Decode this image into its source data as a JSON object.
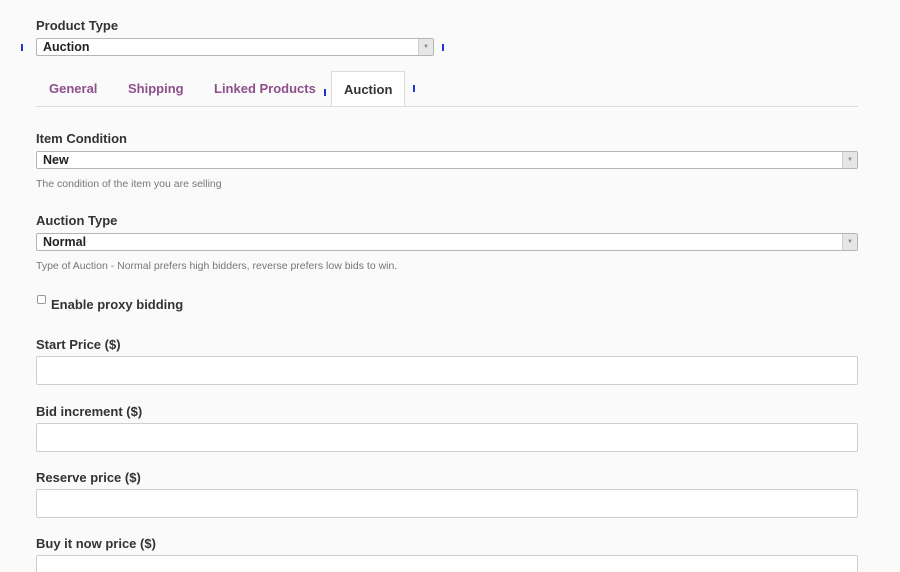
{
  "product_type": {
    "label": "Product Type",
    "value": "Auction"
  },
  "tabs": [
    {
      "label": "General",
      "active": false
    },
    {
      "label": "Shipping",
      "active": false
    },
    {
      "label": "Linked Products",
      "active": false
    },
    {
      "label": "Auction",
      "active": true
    }
  ],
  "item_condition": {
    "label": "Item Condition",
    "value": "New",
    "help": "The condition of the item you are selling"
  },
  "auction_type": {
    "label": "Auction Type",
    "value": "Normal",
    "help": "Type of Auction - Normal prefers high bidders, reverse prefers low bids to win."
  },
  "proxy_bidding": {
    "label": "Enable proxy bidding",
    "checked": false
  },
  "fields": {
    "start_price": {
      "label": "Start Price ($)",
      "value": ""
    },
    "bid_increment": {
      "label": "Bid increment ($)",
      "value": ""
    },
    "reserve_price": {
      "label": "Reserve price ($)",
      "value": ""
    },
    "buy_now_price": {
      "label": "Buy it now price ($)",
      "value": ""
    }
  },
  "colors": {
    "tab_link": "#8e4f8b",
    "marker": "#2233cc"
  },
  "icons": {
    "dropdown": "chevron-down-icon"
  }
}
